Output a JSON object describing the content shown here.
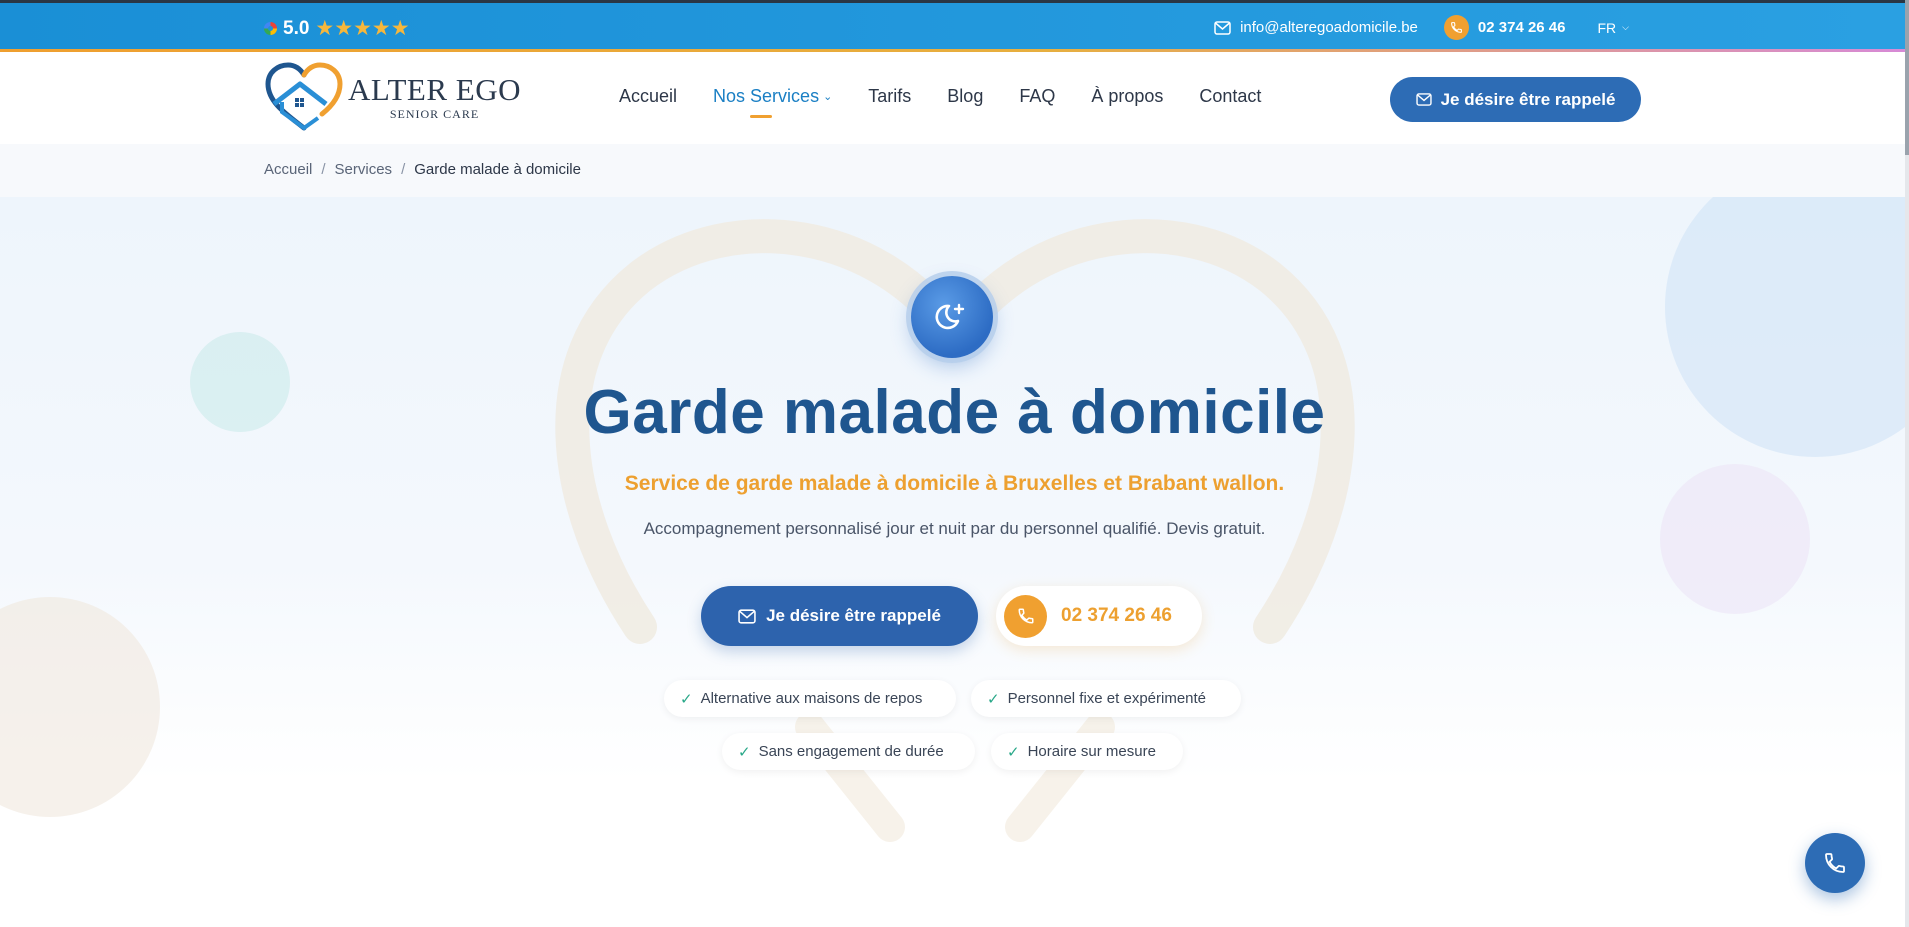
{
  "topbar": {
    "rating": "5.0",
    "stars": "★★★★★",
    "email": "info@alteregoadomicile.be",
    "phone": "02 374 26 46",
    "lang": "FR"
  },
  "logo": {
    "name": "ALTER EGO",
    "sub": "SENIOR CARE"
  },
  "nav": {
    "items": [
      {
        "label": "Accueil"
      },
      {
        "label": "Nos Services"
      },
      {
        "label": "Tarifs"
      },
      {
        "label": "Blog"
      },
      {
        "label": "FAQ"
      },
      {
        "label": "À propos"
      },
      {
        "label": "Contact"
      }
    ],
    "cta": "Je désire être rappelé"
  },
  "breadcrumb": {
    "items": [
      "Accueil",
      "Services",
      "Garde malade à domicile"
    ],
    "sep": "/"
  },
  "hero": {
    "title": "Garde malade à domicile",
    "subtitle": "Service de garde malade à domicile à Bruxelles et Brabant wallon.",
    "description": "Accompagnement personnalisé jour et nuit par du personnel qualifié. Devis gratuit.",
    "cta_primary": "Je désire être rappelé",
    "cta_phone": "02 374 26 46",
    "features": [
      "Alternative aux maisons de repos",
      "Personnel fixe et expérimenté",
      "Sans engagement de durée",
      "Horaire sur mesure"
    ]
  },
  "colors": {
    "primary": "#2d63ad",
    "accent": "#f0a030",
    "title": "#1f568f",
    "check": "#2aa889"
  }
}
